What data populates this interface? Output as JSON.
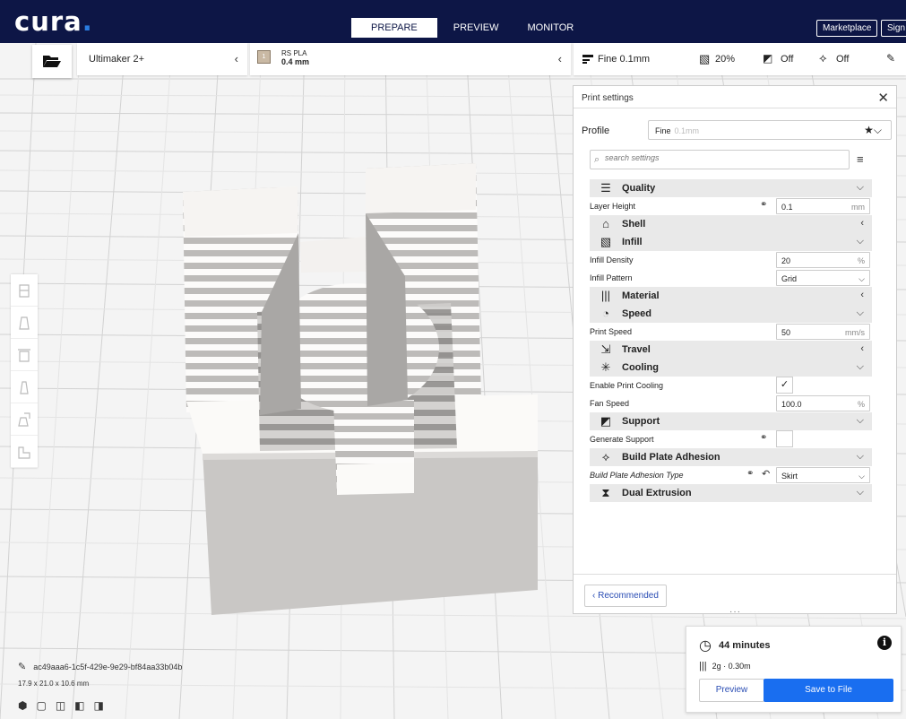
{
  "app": {
    "logo": "cura",
    "logo_dot": "."
  },
  "stages": [
    "PREPARE",
    "PREVIEW",
    "MONITOR"
  ],
  "active_stage": "PREPARE",
  "topbar_buttons": {
    "marketplace": "Marketplace",
    "signin": "Sign in"
  },
  "printer": {
    "name": "Ultimaker 2+"
  },
  "material": {
    "extruder": "1",
    "name": "RS PLA",
    "nozzle": "0.4 mm"
  },
  "settings_bar": {
    "profile": "Fine 0.1mm",
    "infill": "20%",
    "support": "Off",
    "adhesion": "Off"
  },
  "print_settings": {
    "title": "Print settings",
    "profile_label": "Profile",
    "profile_value": "Fine",
    "profile_sub": "0.1mm",
    "search_placeholder": "search settings",
    "categories": [
      {
        "name": "Quality",
        "icon": "quality-icon",
        "expanded": true,
        "rows": [
          {
            "name": "Layer Height",
            "value": "0.1",
            "unit": "mm",
            "linked": true
          }
        ]
      },
      {
        "name": "Shell",
        "icon": "shell-icon",
        "expanded": false,
        "rows": []
      },
      {
        "name": "Infill",
        "icon": "infill-icon",
        "expanded": true,
        "rows": [
          {
            "name": "Infill Density",
            "value": "20",
            "unit": "%"
          },
          {
            "name": "Infill Pattern",
            "value": "Grid",
            "dropdown": true
          }
        ]
      },
      {
        "name": "Material",
        "icon": "material-icon",
        "expanded": false,
        "rows": []
      },
      {
        "name": "Speed",
        "icon": "speed-icon",
        "expanded": true,
        "rows": [
          {
            "name": "Print Speed",
            "value": "50",
            "unit": "mm/s"
          }
        ]
      },
      {
        "name": "Travel",
        "icon": "travel-icon",
        "expanded": false,
        "rows": []
      },
      {
        "name": "Cooling",
        "icon": "cooling-icon",
        "expanded": true,
        "rows": [
          {
            "name": "Enable Print Cooling",
            "checkbox": true,
            "checked": true
          },
          {
            "name": "Fan Speed",
            "value": "100.0",
            "unit": "%"
          }
        ]
      },
      {
        "name": "Support",
        "icon": "support-icon",
        "expanded": true,
        "rows": [
          {
            "name": "Generate Support",
            "checkbox": true,
            "checked": false,
            "linked": true
          }
        ]
      },
      {
        "name": "Build Plate Adhesion",
        "icon": "adhesion-icon",
        "expanded": true,
        "rows": [
          {
            "name": "Build Plate Adhesion Type",
            "value": "Skirt",
            "dropdown": true,
            "linked": true,
            "reset": true,
            "italic": true
          }
        ]
      },
      {
        "name": "Dual Extrusion",
        "icon": "dual-extrusion-icon",
        "expanded": true,
        "rows": []
      }
    ],
    "recommended_button": "Recommended"
  },
  "object": {
    "id": "ac49aaa6-1c5f-429e-9e29-bf84aa33b04b",
    "dimensions": "17.9 x 21.0 x 10.6 mm"
  },
  "print_info": {
    "time": "44 minutes",
    "material_usage": "2g · 0.30m",
    "preview_button": "Preview",
    "save_button": "Save to File"
  },
  "colors": {
    "topbar": "#0d1646",
    "accent": "#196ef0",
    "link": "#2a4db4"
  }
}
